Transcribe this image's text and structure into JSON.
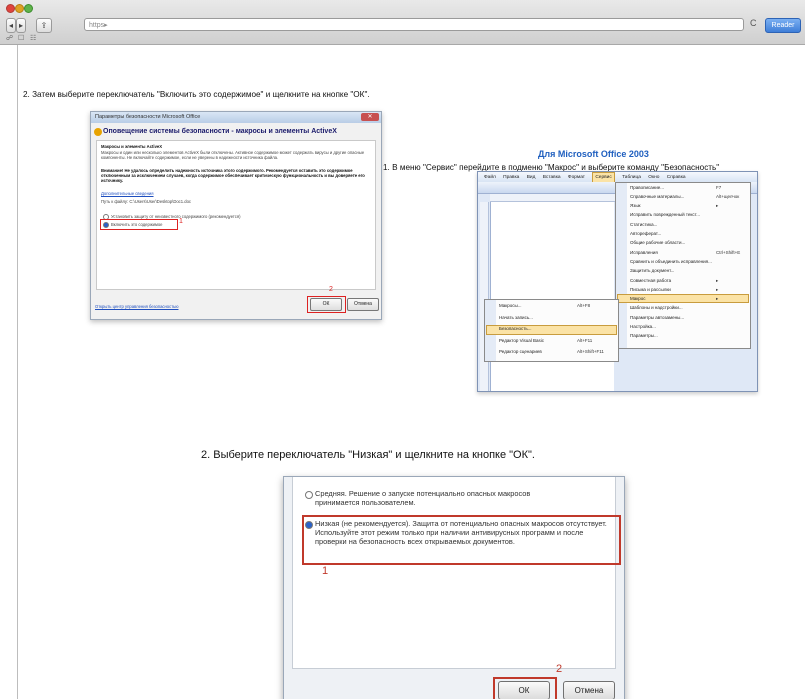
{
  "browser": {
    "address": "https▸",
    "reader_label": "Reader",
    "refresh_glyph": "C",
    "nav_back": "◂",
    "nav_fwd": "▸",
    "bookmarks": [
      "☍",
      "☐",
      "☷"
    ]
  },
  "page": {
    "step2a": "2. Затем выберите переключатель \"Включить это содержимое\" и щелкните на кнопке \"ОК\".",
    "office_heading": "Для Microsoft Office 2003",
    "step1": "1. В меню \"Сервис\" перейдите в подменю \"Макрос\" и выберите команду \"Безопасность\"",
    "step2b": "2. Выберите переключатель \"Низкая\" и щелкните на кнопке \"ОК\"."
  },
  "dialog1": {
    "title": "Параметры безопасности Microsoft Office",
    "heading": "Оповещение системы безопасности - макросы и элементы ActiveX",
    "section": "Макросы и элементы ActiveX",
    "desc": "Макросы и один или несколько элементов ActiveX были отключены. Активное содержимое может содержать вирусы и другие опасные компоненты. Не включайте содержимое, если не уверены в надежности источника файла.",
    "warning": "Внимание! Не удалось определить надежность источника этого содержимого. Рекомендуется оставить это содержимое отключенным за исключением случаев, когда содержимое обеспечивает критическую функциональность и вы доверяете его источнику.",
    "more_info": "Дополнительные сведения",
    "path": "Путь к файлу:   C:\\Users\\User\\Desktop\\Doc1.doc",
    "option_protect": "Установить защиту от неизвестного содержимого (рекомендуется)",
    "option_enable": "Включить это содержимое",
    "trust_center": "Открыть центр управления безопасностью",
    "ok": "ОК",
    "cancel": "Отмена",
    "mark1": "1",
    "mark2": "2"
  },
  "office2003": {
    "menubar": [
      "Файл",
      "Правка",
      "Вид",
      "Вставка",
      "Формат",
      "Сервис",
      "Таблица",
      "Окно",
      "Справка"
    ],
    "service_menu": [
      {
        "label": "Правописание...",
        "shortcut": "F7"
      },
      {
        "label": "Справочные материалы...",
        "shortcut": "Alt+щелчок"
      },
      {
        "label": "Язык",
        "shortcut": "▸"
      },
      {
        "label": "Исправить поврежденный текст...",
        "shortcut": ""
      },
      {
        "label": "Статистика...",
        "shortcut": ""
      },
      {
        "label": "Автореферат...",
        "shortcut": ""
      },
      {
        "label": "Общие рабочие области...",
        "shortcut": ""
      },
      {
        "label": "Исправления",
        "shortcut": "Ctrl+Shift+E"
      },
      {
        "label": "Сравнить и объединить исправления...",
        "shortcut": ""
      },
      {
        "label": "Защитить документ...",
        "shortcut": ""
      },
      {
        "label": "Совместная работа",
        "shortcut": "▸"
      },
      {
        "label": "Письма и рассылки",
        "shortcut": "▸"
      },
      {
        "label": "Макрос",
        "shortcut": "▸"
      },
      {
        "label": "Шаблоны и надстройки...",
        "shortcut": ""
      },
      {
        "label": "Параметры автозамены...",
        "shortcut": ""
      },
      {
        "label": "Настройка...",
        "shortcut": ""
      },
      {
        "label": "Параметры...",
        "shortcut": ""
      }
    ],
    "macro_menu": [
      {
        "label": "Макросы...",
        "shortcut": "Alt+F8"
      },
      {
        "label": "Начать запись...",
        "shortcut": ""
      },
      {
        "label": "Безопасность...",
        "shortcut": ""
      },
      {
        "label": "Редактор Visual Basic",
        "shortcut": "Alt+F11"
      },
      {
        "label": "Редактор сценариев",
        "shortcut": "Alt+Shift+F11"
      }
    ]
  },
  "dialog3": {
    "option_medium": "Средняя. Решение о запуске потенциально опасных макросов принимается пользователем.",
    "option_low": "Низкая (не рекомендуется). Защита от потенциально опасных макросов отсутствует. Используйте этот режим только при наличии антивирусных программ и после проверки на безопасность всех открываемых документов.",
    "ok": "ОК",
    "cancel": "Отмена",
    "mark1": "1",
    "mark2": "2"
  },
  "colors": {
    "annotation": "#dd2222",
    "heading_blue": "#1f5fbf"
  }
}
